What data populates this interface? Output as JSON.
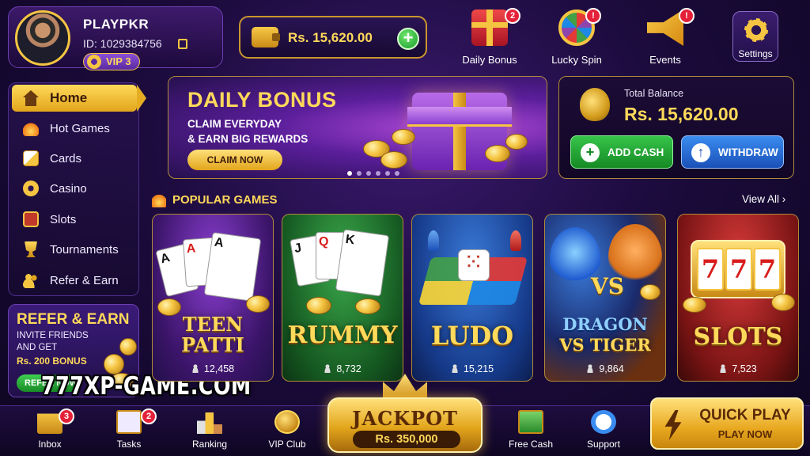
{
  "profile": {
    "name": "PLAYPKR",
    "id_text": "ID: 1029384756",
    "vip": "VIP 3"
  },
  "wallet": {
    "amount": "Rs. 15,620.00",
    "add_label": "+"
  },
  "top_actions": [
    {
      "label": "Daily Bonus",
      "badge": "2",
      "icon": "gift-icon"
    },
    {
      "label": "Lucky Spin",
      "badge": "!",
      "icon": "spin-wheel-icon"
    },
    {
      "label": "Events",
      "badge": "!",
      "icon": "megaphone-icon"
    }
  ],
  "settings": {
    "label": "Settings"
  },
  "sidebar": {
    "items": [
      {
        "label": "Home",
        "icon": "home-icon"
      },
      {
        "label": "Hot Games",
        "icon": "fire-icon"
      },
      {
        "label": "Cards",
        "icon": "cards-icon"
      },
      {
        "label": "Casino",
        "icon": "casino-chip-icon"
      },
      {
        "label": "Slots",
        "icon": "slots-icon"
      },
      {
        "label": "Tournaments",
        "icon": "trophy-icon"
      },
      {
        "label": "Refer & Earn",
        "icon": "users-icon"
      }
    ]
  },
  "refer": {
    "title": "REFER & EARN",
    "line1": "INVITE FRIENDS",
    "line2": "AND GET",
    "bonus": "Rs. 200 BONUS",
    "button": "REFER NOW"
  },
  "watermark": "777XP-GAME.COM",
  "banner": {
    "title": "DAILY BONUS",
    "line1": "CLAIM EVERYDAY",
    "line2": "& EARN BIG REWARDS",
    "button": "CLAIM NOW",
    "slide_count": 6,
    "active_slide": 0
  },
  "balance": {
    "label": "Total Balance",
    "amount": "Rs. 15,620.00",
    "add_cash": "ADD CASH",
    "withdraw": "WITHDRAW"
  },
  "popular": {
    "title": "POPULAR GAMES",
    "view_all": "View All ›",
    "games": [
      {
        "name_line1": "TEEN",
        "name_line2": "PATTI",
        "players": "12,458"
      },
      {
        "name_line1": "RUMMY",
        "name_line2": "",
        "players": "8,732"
      },
      {
        "name_line1": "LUDO",
        "name_line2": "",
        "players": "15,215"
      },
      {
        "name_line1": "DRAGON",
        "name_line2": "VS TIGER",
        "vs": "VS",
        "players": "9,864"
      },
      {
        "name_line1": "SLOTS",
        "name_line2": "",
        "reels": [
          "7",
          "7",
          "7"
        ],
        "players": "7,523"
      }
    ]
  },
  "bottom_nav": [
    {
      "label": "Inbox",
      "badge": "3",
      "icon": "mail-icon"
    },
    {
      "label": "Tasks",
      "badge": "2",
      "icon": "tasks-icon"
    },
    {
      "label": "Ranking",
      "badge": "",
      "icon": "podium-icon"
    },
    {
      "label": "VIP Club",
      "badge": "",
      "icon": "vip-icon"
    },
    {
      "label": "Free Cash",
      "badge": "",
      "icon": "cash-icon"
    },
    {
      "label": "Support",
      "badge": "",
      "icon": "headset-icon"
    }
  ],
  "jackpot": {
    "title": "JACKPOT",
    "amount": "Rs. 350,000"
  },
  "quick_play": {
    "title": "QUICK PLAY",
    "sub": "PLAY NOW"
  },
  "cards_teen": [
    "A",
    "A",
    "A"
  ],
  "cards_rummy": [
    "J",
    "Q",
    "K"
  ],
  "colors": {
    "gold": "#ffd95a",
    "purple": "#3a1a6e",
    "green": "#36c44a",
    "blue": "#3a8cf0",
    "red": "#e5213a"
  }
}
